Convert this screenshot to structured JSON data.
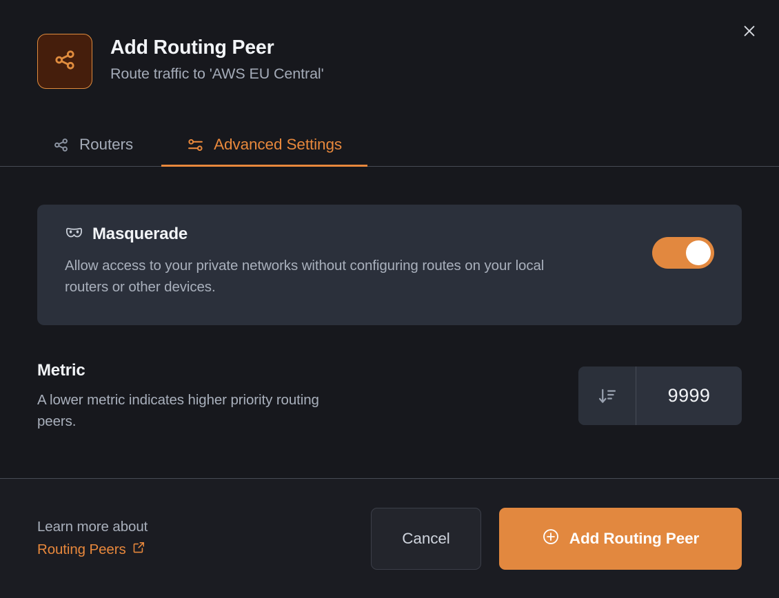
{
  "header": {
    "title": "Add Routing Peer",
    "subtitle": "Route traffic to 'AWS EU Central'",
    "icon": "share-nodes-icon",
    "close_icon": "close-icon",
    "accent_color": "#e8883c",
    "icon_bg_color": "#451e0c"
  },
  "tabs": [
    {
      "label": "Routers",
      "icon": "share-nodes-icon",
      "active": false
    },
    {
      "label": "Advanced Settings",
      "icon": "sliders-horizontal-icon",
      "active": true
    }
  ],
  "masquerade": {
    "icon": "mask-icon",
    "title": "Masquerade",
    "description": "Allow access to your private networks without configuring routes on your local routers or other devices.",
    "toggle_on": true,
    "toggle_color": "#e2883f"
  },
  "metric": {
    "title": "Metric",
    "description": "A lower metric indicates higher priority routing peers.",
    "input_icon": "sort-descending-icon",
    "value": "9999",
    "placeholder": "9999"
  },
  "footer": {
    "learn_more_text": "Learn more about",
    "learn_more_link": "Routing Peers",
    "external_link_icon": "external-link-icon",
    "cancel_label": "Cancel",
    "submit_label": "Add Routing Peer",
    "submit_icon": "plus-circle-icon"
  }
}
